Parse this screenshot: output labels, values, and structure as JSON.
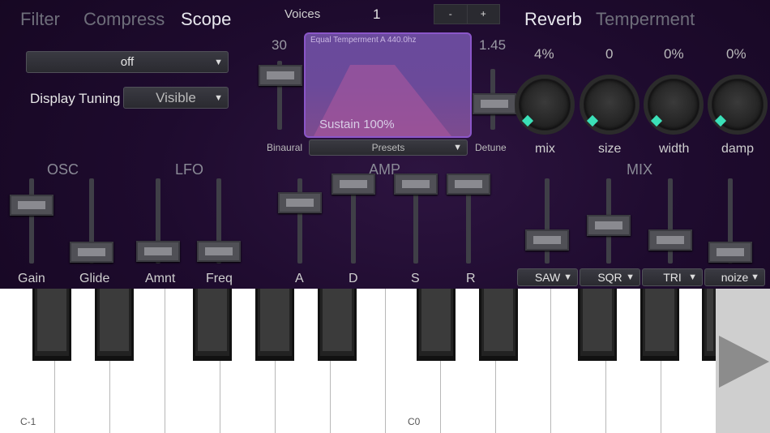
{
  "tabs_left": [
    "Filter",
    "Compress",
    "Scope"
  ],
  "tabs_right": [
    "Reverb",
    "Temperment"
  ],
  "filter_dropdown": "off",
  "display_tuning": {
    "label": "Display Tuning",
    "value": "Visible"
  },
  "voices": {
    "label": "Voices",
    "value": "1",
    "minus": "-",
    "plus": "+"
  },
  "binaural": {
    "label": "Binaural",
    "value": "30"
  },
  "detune": {
    "label": "Detune",
    "value": "1.45"
  },
  "scope": {
    "tuning": "Equal Temperment A 440.0hz",
    "sustain": "Sustain 100%"
  },
  "presets": "Presets",
  "reverb": {
    "knobs": [
      {
        "value": "4%",
        "label": "mix"
      },
      {
        "value": "0",
        "label": "size"
      },
      {
        "value": "0%",
        "label": "width"
      },
      {
        "value": "0%",
        "label": "damp"
      }
    ]
  },
  "sections": {
    "osc": "OSC",
    "lfo": "LFO",
    "amp": "AMP",
    "mix": "MIX"
  },
  "slider_labels": [
    "Gain",
    "Glide",
    "Amnt",
    "Freq",
    "A",
    "D",
    "S",
    "R"
  ],
  "waveforms": [
    "SAW",
    "SQR",
    "TRI",
    "noize"
  ],
  "keyboard": {
    "labels": [
      "C-1",
      "C0"
    ]
  },
  "icons": {
    "caret": "▼",
    "next": "play-triangle-icon"
  },
  "colors": {
    "accent": "#3be0b8",
    "scope_border": "#8b56c9"
  }
}
